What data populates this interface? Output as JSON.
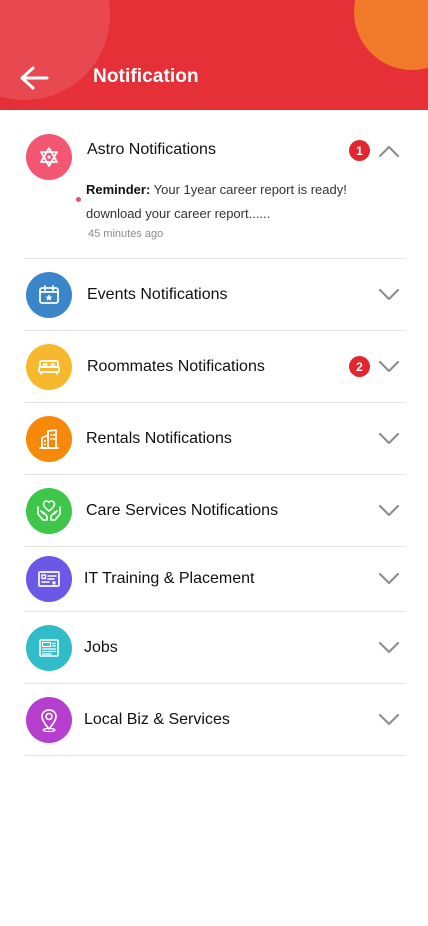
{
  "header": {
    "title": "Notification",
    "back_icon": "arrow-left-icon",
    "bg_color": "#e53038",
    "accent_color": "#f07a2a"
  },
  "categories": [
    {
      "label": "Astro Notifications",
      "icon": "star-of-david-icon",
      "color": "#f25672",
      "badge": "1",
      "expanded": true,
      "notification": {
        "prefix": "Reminder:",
        "text": " Your 1year career report is ready! download your career report......",
        "time": "45 minutes ago"
      }
    },
    {
      "label": "Events Notifications",
      "icon": "calendar-star-icon",
      "color": "#3a86c8",
      "badge": "",
      "expanded": false
    },
    {
      "label": "Roommates Notifications",
      "icon": "bed-icon",
      "color": "#f6b82d",
      "badge": "2",
      "expanded": false
    },
    {
      "label": "Rentals Notifications",
      "icon": "building-icon",
      "color": "#f6890a",
      "badge": "",
      "expanded": false
    },
    {
      "label": "Care Services Notifications",
      "icon": "caring-hands-heart-icon",
      "color": "#3ec64a",
      "badge": "",
      "expanded": false
    },
    {
      "label": "IT Training & Placement",
      "icon": "certificate-icon",
      "color": "#6b58e6",
      "badge": "",
      "expanded": false
    },
    {
      "label": "Jobs",
      "icon": "jobs-newspaper-icon",
      "color": "#31bcca",
      "badge": "",
      "expanded": false
    },
    {
      "label": "Local Biz & Services",
      "icon": "location-pin-icon",
      "color": "#b63ecf",
      "badge": "",
      "expanded": false
    }
  ]
}
